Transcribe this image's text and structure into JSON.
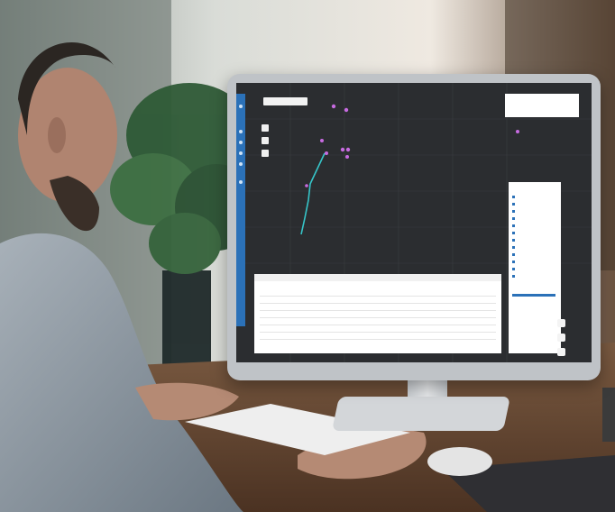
{
  "scene": {
    "description_free": true,
    "colors": {
      "wall": "#e9e6e0",
      "desk": "#6b4a33",
      "screen_bg": "#2b2d30",
      "accent_blue": "#2b71b8",
      "route_line": "#36c5c9",
      "poi_marker": "#c76be0"
    }
  },
  "screen": {
    "icons": [
      "search-icon",
      "zoom-in-icon",
      "zoom-out-icon",
      "layers-icon",
      "legend-icon",
      "table-icon"
    ]
  }
}
